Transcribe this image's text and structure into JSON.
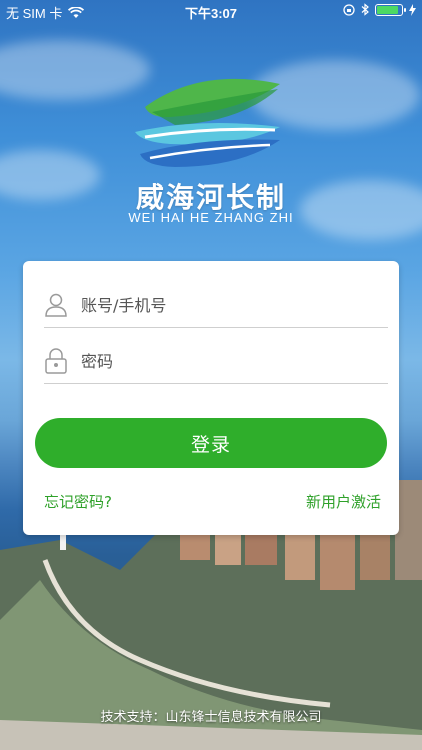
{
  "status_bar": {
    "carrier": "无 SIM 卡",
    "time": "下午3:07",
    "battery_level": 0.9
  },
  "brand": {
    "title": "威海河长制",
    "subtitle": "WEI HAI HE ZHANG ZHI"
  },
  "login": {
    "account_placeholder": "账号/手机号",
    "password_placeholder": "密码",
    "submit_label": "登录",
    "forgot_label": "忘记密码?",
    "activate_label": "新用户激活"
  },
  "footer": {
    "text": "技术支持：山东锋士信息技术有限公司"
  },
  "colors": {
    "accent": "#2fae2b",
    "link": "#2fa12a"
  }
}
